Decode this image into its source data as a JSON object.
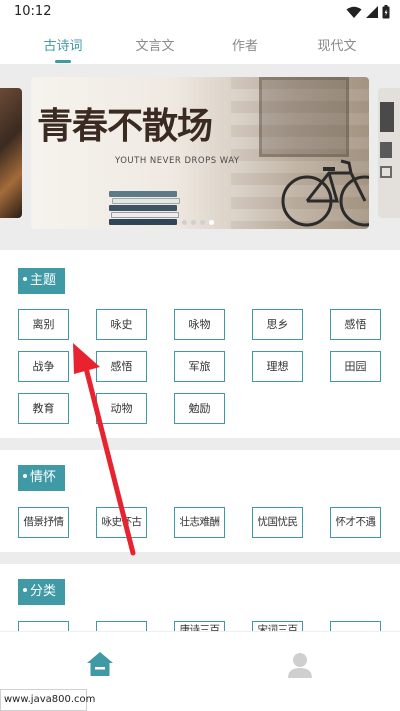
{
  "status_bar": {
    "time": "10:12",
    "icons": [
      "wifi-icon",
      "signal-icon",
      "battery-icon"
    ]
  },
  "top_tabs": [
    {
      "label": "古诗词",
      "active": true
    },
    {
      "label": "文言文",
      "active": false
    },
    {
      "label": "作者",
      "active": false
    },
    {
      "label": "现代文",
      "active": false
    }
  ],
  "banner": {
    "title": "青春不散场",
    "subtitle": "YOUTH NEVER DROPS WAY",
    "page_count": 4,
    "active_page": 4
  },
  "sections": {
    "theme": {
      "title": "主题",
      "items": [
        "离别",
        "咏史",
        "咏物",
        "思乡",
        "感悟",
        "战争",
        "感悟",
        "军旅",
        "理想",
        "田园",
        "教育",
        "动物",
        "勉励"
      ]
    },
    "feeling": {
      "title": "情怀",
      "items": [
        "借景抒情",
        "咏史怀古",
        "壮志难酬",
        "忧国忧民",
        "怀才不遇"
      ]
    },
    "category": {
      "title": "分类",
      "items": [
        "",
        "",
        "唐诗三百",
        "宋词三百",
        ""
      ]
    }
  },
  "bottom_nav": {
    "items": [
      "home-icon",
      "user-icon"
    ],
    "active": "home-icon"
  },
  "watermark": "www.java800.com",
  "colors": {
    "accent": "#3f9aa6",
    "annotation_arrow": "#e8232f",
    "background_gray": "#ececec"
  }
}
